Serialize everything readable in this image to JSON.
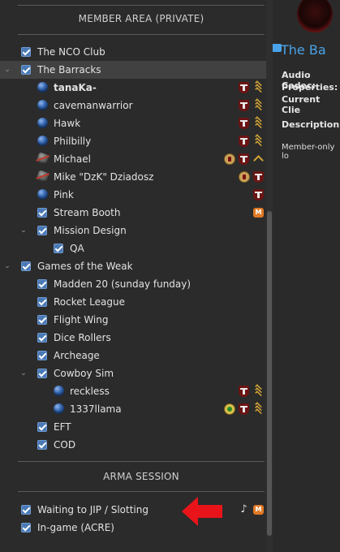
{
  "sections": {
    "member_area": "MEMBER AREA (PRIVATE)",
    "arma_session": "ARMA SESSION"
  },
  "tree": [
    {
      "label": "The NCO Club",
      "type": "channel",
      "indent": 0
    },
    {
      "label": "The Barracks",
      "type": "channel",
      "expanded": true,
      "selected": true
    },
    {
      "label": "tanaKa-",
      "type": "user",
      "bold": true,
      "icons": [
        "cross-badge-icon",
        "sergeant-chevrons-icon"
      ]
    },
    {
      "label": "cavemanwarrior",
      "type": "user",
      "icons": [
        "cross-badge-icon",
        "sergeant-chevrons-icon"
      ]
    },
    {
      "label": "Hawk",
      "type": "user",
      "icons": [
        "cross-badge-icon",
        "sergeant-chevrons-icon"
      ]
    },
    {
      "label": "Philbilly",
      "type": "user",
      "icons": [
        "cross-badge-icon",
        "sergeant-chevrons-icon"
      ]
    },
    {
      "label": "Michael",
      "type": "user",
      "muted": true,
      "icons": [
        "coin-badge-icon",
        "cross-badge-icon",
        "private-chevron-icon"
      ]
    },
    {
      "label": "Mike \"DzK\" Dziadosz",
      "type": "user",
      "muted": true,
      "icons": [
        "coin-badge-icon",
        "cross-badge-icon"
      ]
    },
    {
      "label": "Pink",
      "type": "user",
      "icons": [
        "cross-badge-icon"
      ]
    },
    {
      "label": "Stream Booth",
      "type": "channel",
      "icons": [
        "moderated-icon"
      ]
    },
    {
      "label": "Mission Design",
      "type": "channel",
      "expanded": true
    },
    {
      "label": "QA",
      "type": "channel"
    },
    {
      "label": "Games of the Weak",
      "type": "channel",
      "expanded": true
    },
    {
      "label": "Madden 20 (sunday funday)",
      "type": "channel"
    },
    {
      "label": "Rocket League",
      "type": "channel"
    },
    {
      "label": "Flight Wing",
      "type": "channel"
    },
    {
      "label": "Dice Rollers",
      "type": "channel"
    },
    {
      "label": "Archeage",
      "type": "channel"
    },
    {
      "label": "Cowboy Sim",
      "type": "channel",
      "expanded": true
    },
    {
      "label": "reckless",
      "type": "user",
      "icons": [
        "cross-badge-icon",
        "sergeant-chevrons-icon"
      ]
    },
    {
      "label": "1337llama",
      "type": "user",
      "icons": [
        "green-coin-badge-icon",
        "cross-badge-icon",
        "sergeant-chevrons-icon"
      ]
    },
    {
      "label": "EFT",
      "type": "channel"
    },
    {
      "label": "COD",
      "type": "channel"
    }
  ],
  "arma": [
    {
      "label": "Waiting to JIP / Slotting",
      "icons": [
        "music-note-icon",
        "moderated-icon"
      ]
    },
    {
      "label": "In-game (ACRE)"
    }
  ],
  "moderated_glyph": "M",
  "music_glyph": "♪",
  "right_panel": {
    "title": "The Ba",
    "audio_codec": "Audio Codec:",
    "properties": "Properties:",
    "current_client": "Current Clie",
    "description": "Description:",
    "desc_text": "Member-only lo"
  },
  "colors": {
    "accent_blue": "#4aa3e8",
    "arrow_red": "#e8141a",
    "chevron_gold": "#d4a637"
  }
}
